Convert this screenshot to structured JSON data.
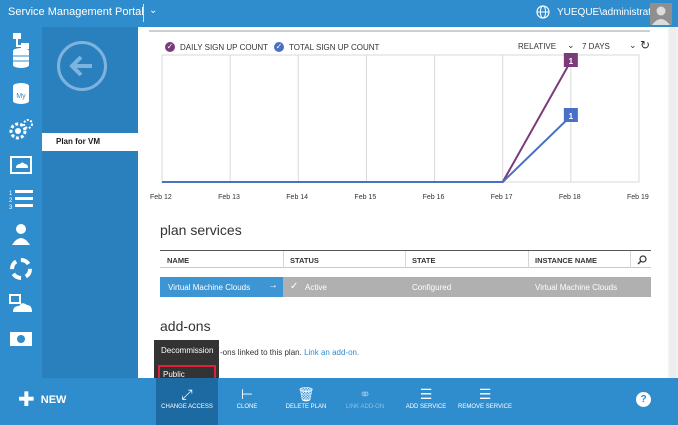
{
  "topbar": {
    "title": "Service Management Portal",
    "user": "YUEQUE\\administrator"
  },
  "sidebar": {
    "subitem": "Plan for VM"
  },
  "legend": {
    "daily": "DAILY SIGN UP COUNT",
    "total": "TOTAL SIGN UP COUNT",
    "daily_color": "#7b3b7a",
    "total_color": "#4a6fc7",
    "range_mode": "RELATIVE",
    "range": "7 DAYS"
  },
  "chart_data": {
    "type": "line",
    "categories": [
      "Feb 12",
      "Feb 13",
      "Feb 14",
      "Feb 15",
      "Feb 16",
      "Feb 17",
      "Feb 18",
      "Feb 19"
    ],
    "series": [
      {
        "name": "DAILY SIGN UP COUNT",
        "values": [
          0,
          0,
          0,
          0,
          0,
          0,
          1,
          null
        ]
      },
      {
        "name": "TOTAL SIGN UP COUNT",
        "values": [
          0,
          0,
          0,
          0,
          0,
          0,
          1,
          null
        ]
      }
    ],
    "data_labels": [
      "1",
      "1"
    ]
  },
  "plan_services": {
    "title": "plan services",
    "columns": [
      "NAME",
      "STATUS",
      "STATE",
      "INSTANCE NAME"
    ],
    "row": {
      "name": "Virtual Machine Clouds",
      "status": "Active",
      "state": "Configured",
      "instance": "Virtual Machine Clouds"
    }
  },
  "addons": {
    "title": "add-ons",
    "text": "-ons linked to this plan.",
    "link": "Link an add-on."
  },
  "popup": {
    "items": [
      "Decommission",
      "Public"
    ]
  },
  "bottombar": {
    "new": "NEW",
    "commands": [
      "CHANGE ACCESS",
      "CLONE",
      "DELETE PLAN",
      "LINK ADD-ON",
      "ADD SERVICE",
      "REMOVE SERVICE"
    ],
    "help": "?"
  },
  "colors": {
    "accent": "#2f8ccd",
    "dark_accent": "#2a80bd",
    "row_highlight": "#3d95d4",
    "popup_border": "#e0213a"
  }
}
